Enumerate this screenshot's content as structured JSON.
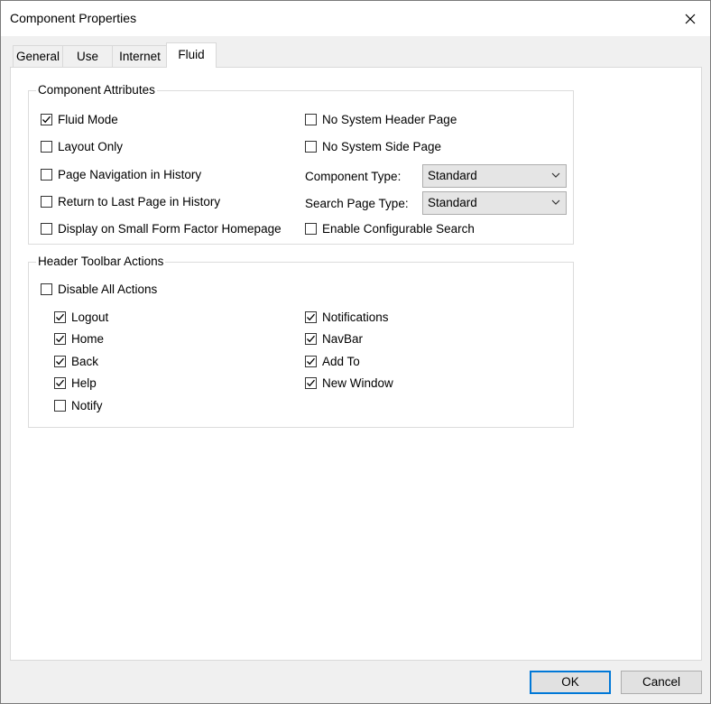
{
  "window": {
    "title": "Component Properties"
  },
  "tabs": [
    {
      "label": "General"
    },
    {
      "label": "Use"
    },
    {
      "label": "Internet"
    },
    {
      "label": "Fluid"
    }
  ],
  "component_attributes": {
    "title": "Component Attributes",
    "fluid_mode": {
      "label": "Fluid Mode",
      "checked": true
    },
    "layout_only": {
      "label": "Layout Only",
      "checked": false
    },
    "page_navigation_in_history": {
      "label": "Page Navigation in History",
      "checked": false
    },
    "return_to_last_page": {
      "label": "Return to Last Page in History",
      "checked": false
    },
    "display_small_form_factor": {
      "label": "Display on Small Form Factor Homepage",
      "checked": false
    },
    "no_system_header_page": {
      "label": "No System Header Page",
      "checked": false
    },
    "no_system_side_page": {
      "label": "No System Side Page",
      "checked": false
    },
    "component_type": {
      "label": "Component Type:",
      "value": "Standard"
    },
    "search_page_type": {
      "label": "Search Page Type:",
      "value": "Standard"
    },
    "enable_configurable_search": {
      "label": "Enable Configurable Search",
      "checked": false
    }
  },
  "header_toolbar": {
    "title": "Header Toolbar Actions",
    "disable_all": {
      "label": "Disable All Actions",
      "checked": false
    },
    "logout": {
      "label": "Logout",
      "checked": true
    },
    "home": {
      "label": "Home",
      "checked": true
    },
    "back": {
      "label": "Back",
      "checked": true
    },
    "help": {
      "label": "Help",
      "checked": true
    },
    "notify": {
      "label": "Notify",
      "checked": false
    },
    "notifications": {
      "label": "Notifications",
      "checked": true
    },
    "navbar": {
      "label": "NavBar",
      "checked": true
    },
    "add_to": {
      "label": "Add To",
      "checked": true
    },
    "new_window": {
      "label": "New Window",
      "checked": true
    }
  },
  "buttons": {
    "ok": "OK",
    "cancel": "Cancel"
  },
  "colors": {
    "focus_border": "#0078d7",
    "panel": "#ffffff",
    "window": "#f0f0f0"
  }
}
